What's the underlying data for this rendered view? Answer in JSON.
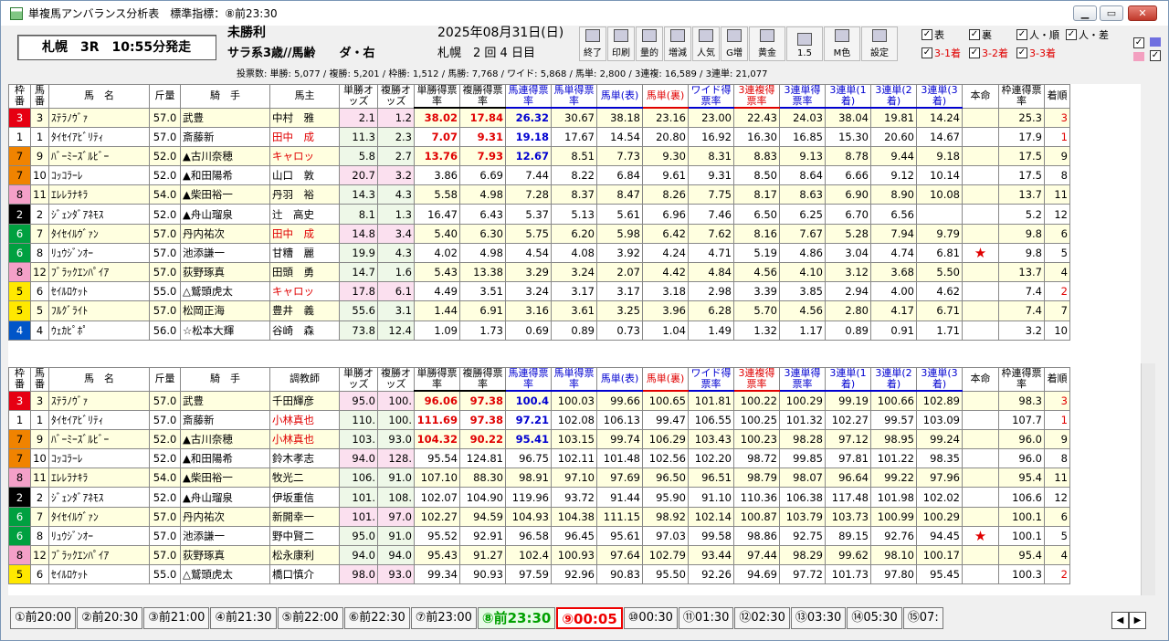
{
  "window": {
    "title": "単複馬アンバランス分析表　標準指標：⑧前23:30"
  },
  "race": {
    "name": "札幌　3R　10:55分発走",
    "condition": "未勝利",
    "detail": "サラ系3歳//馬齢　　ダ・右",
    "date": "2025年08月31日(日)",
    "place": "札幌　2 回 4 日目"
  },
  "votes": "投票数:  単勝: 5,077 / 複勝: 5,201 / 枠勝: 1,512 / 馬勝: 7,768 / ワイド: 5,868 / 馬単: 2,800 / 3連複: 16,589 / 3連単: 21,077",
  "toolbar": [
    "終了",
    "印刷",
    "量的",
    "増減",
    "人気",
    "G増",
    "黄金",
    "1.5",
    "M色",
    "設定"
  ],
  "checks": [
    "表",
    "裏",
    "人・順",
    "人・差",
    "3-1着",
    "3-2着",
    "3-3着"
  ],
  "colors": {
    "w1": "#ffffff",
    "w2": "#000000",
    "w3": "#e60012",
    "w4": "#0055c8",
    "w5": "#ffe800",
    "w6": "#00a040",
    "w7": "#f08300",
    "w8": "#f4a0c8",
    "red": "#e00000",
    "blue": "#0000d0"
  },
  "top": {
    "headers": [
      "枠番",
      "馬番",
      "馬　名",
      "斤量",
      "騎　手",
      "馬主",
      "単勝オッズ",
      "複勝オッズ",
      "単勝得票率",
      "複勝得票率",
      "馬連得票率",
      "馬単得票率",
      "馬単(表)",
      "馬単(裏)",
      "ワイド得票率",
      "3連複得票率",
      "3連単得票率",
      "3連単(1着)",
      "3連単(2着)",
      "3連単(3着)",
      "本命",
      "枠連得票率",
      "着順"
    ],
    "rows": [
      [
        "3",
        "3",
        "ｽﾃﾗﾉｳﾞｧ",
        "57.0",
        "武豊",
        "中村　雅",
        "2.1",
        "1.2",
        "38.02",
        "17.84",
        "26.32",
        "30.67",
        "38.18",
        "23.16",
        "23.00",
        "22.43",
        "24.03",
        "38.04",
        "19.81",
        "14.24",
        "",
        "25.3",
        "3"
      ],
      [
        "1",
        "1",
        "ﾀｲｾｲｱﾋﾞﾘﾃｨ",
        "57.0",
        "斎藤新",
        "田中　成",
        "11.3",
        "2.3",
        "7.07",
        "9.31",
        "19.18",
        "17.67",
        "14.54",
        "20.80",
        "16.92",
        "16.30",
        "16.85",
        "15.30",
        "20.60",
        "14.67",
        "",
        "17.9",
        "1"
      ],
      [
        "7",
        "9",
        "ﾊﾞｰﾐｰｽﾞﾙﾋﾞｰ",
        "52.0",
        "▲古川奈穂",
        "キャロッ",
        "5.8",
        "2.7",
        "13.76",
        "7.93",
        "12.67",
        "8.51",
        "7.73",
        "9.30",
        "8.31",
        "8.83",
        "9.13",
        "8.78",
        "9.44",
        "9.18",
        "",
        "17.5",
        "9"
      ],
      [
        "7",
        "10",
        "ｺｯｺﾗｰﾚ",
        "52.0",
        "▲和田陽希",
        "山口　敦",
        "20.7",
        "3.2",
        "3.86",
        "6.69",
        "7.44",
        "8.22",
        "6.84",
        "9.61",
        "9.31",
        "8.50",
        "8.64",
        "6.66",
        "9.12",
        "10.14",
        "",
        "17.5",
        "8"
      ],
      [
        "8",
        "11",
        "ｴﾚﾚﾗﾅｷﾗ",
        "54.0",
        "▲柴田裕一",
        "丹羽　裕",
        "14.3",
        "4.3",
        "5.58",
        "4.98",
        "7.28",
        "8.37",
        "8.47",
        "8.26",
        "7.75",
        "8.17",
        "8.63",
        "6.90",
        "8.90",
        "10.08",
        "",
        "13.7",
        "11"
      ],
      [
        "2",
        "2",
        "ｼﾞｪﾝﾀﾞｱﾈﾓｽ",
        "52.0",
        "▲舟山瑠泉",
        "辻　高史",
        "8.1",
        "1.3",
        "16.47",
        "6.43",
        "5.37",
        "5.13",
        "5.61",
        "6.96",
        "7.46",
        "6.50",
        "6.25",
        "6.70",
        "6.56",
        "",
        "",
        "5.2",
        "12"
      ],
      [
        "6",
        "7",
        "ﾀｲｾｲﾙｳﾞｧﾝ",
        "57.0",
        "丹内祐次",
        "田中　成",
        "14.8",
        "3.4",
        "5.40",
        "6.30",
        "5.75",
        "6.20",
        "5.98",
        "6.42",
        "7.62",
        "8.16",
        "7.67",
        "5.28",
        "7.94",
        "9.79",
        "",
        "9.8",
        "6"
      ],
      [
        "6",
        "8",
        "ﾘｭｳｼﾞﾝｵｰ",
        "57.0",
        "池添謙一",
        "甘糟　麗",
        "19.9",
        "4.3",
        "4.02",
        "4.98",
        "4.54",
        "4.08",
        "3.92",
        "4.24",
        "4.71",
        "5.19",
        "4.86",
        "3.04",
        "4.74",
        "6.81",
        "★",
        "9.8",
        "5"
      ],
      [
        "8",
        "12",
        "ﾌﾞﾗｯｸｴﾝﾊﾟｲｱ",
        "57.0",
        "荻野琢真",
        "田頭　勇",
        "14.7",
        "1.6",
        "5.43",
        "13.38",
        "3.29",
        "3.24",
        "2.07",
        "4.42",
        "4.84",
        "4.56",
        "4.10",
        "3.12",
        "3.68",
        "5.50",
        "",
        "13.7",
        "4"
      ],
      [
        "5",
        "6",
        "ｾｲﾙﾛｹｯﾄ",
        "55.0",
        "△鷲頭虎太",
        "キャロッ",
        "17.8",
        "6.1",
        "4.49",
        "3.51",
        "3.24",
        "3.17",
        "3.17",
        "3.18",
        "2.98",
        "3.39",
        "3.85",
        "2.94",
        "4.00",
        "4.62",
        "",
        "7.4",
        "2"
      ],
      [
        "5",
        "5",
        "ﾌﾙｸﾞﾗｲﾄ",
        "57.0",
        "松岡正海",
        "豊井　義",
        "55.6",
        "3.1",
        "1.44",
        "6.91",
        "3.16",
        "3.61",
        "3.25",
        "3.96",
        "6.28",
        "5.70",
        "4.56",
        "2.80",
        "4.17",
        "6.71",
        "",
        "7.4",
        "7"
      ],
      [
        "4",
        "4",
        "ｳｪｶﾋﾟﾎﾟ",
        "56.0",
        "☆松本大輝",
        "谷崎　森",
        "73.8",
        "12.4",
        "1.09",
        "1.73",
        "0.69",
        "0.89",
        "0.73",
        "1.04",
        "1.49",
        "1.32",
        "1.17",
        "0.89",
        "0.91",
        "1.71",
        "",
        "3.2",
        "10"
      ]
    ]
  },
  "bottom": {
    "headers": [
      "枠番",
      "馬番",
      "馬　名",
      "斤量",
      "騎　手",
      "調教師",
      "単勝オッズ",
      "複勝オッズ",
      "単勝得票率",
      "複勝得票率",
      "馬連得票率",
      "馬単得票率",
      "馬単(表)",
      "馬単(裏)",
      "ワイド得票率",
      "3連複得票率",
      "3連単得票率",
      "3連単(1着)",
      "3連単(2着)",
      "3連単(3着)",
      "本命",
      "枠連得票率",
      "着順"
    ],
    "rows": [
      [
        "3",
        "3",
        "ｽﾃﾗﾉｳﾞｧ",
        "57.0",
        "武豊",
        "千田輝彦",
        "95.0",
        "100.",
        "96.06",
        "97.38",
        "100.4",
        "100.03",
        "99.66",
        "100.65",
        "101.81",
        "100.22",
        "100.29",
        "99.19",
        "100.66",
        "102.89",
        "",
        "98.3",
        "3"
      ],
      [
        "1",
        "1",
        "ﾀｲｾｲｱﾋﾞﾘﾃｨ",
        "57.0",
        "斎藤新",
        "小林真也",
        "110.",
        "100.",
        "111.69",
        "97.38",
        "97.21",
        "102.08",
        "106.13",
        "99.47",
        "106.55",
        "100.25",
        "101.32",
        "102.27",
        "99.57",
        "103.09",
        "",
        "107.7",
        "1"
      ],
      [
        "7",
        "9",
        "ﾊﾞｰﾐｰｽﾞﾙﾋﾞｰ",
        "52.0",
        "▲古川奈穂",
        "小林真也",
        "103.",
        "93.0",
        "104.32",
        "90.22",
        "95.41",
        "103.15",
        "99.74",
        "106.29",
        "103.43",
        "100.23",
        "98.28",
        "97.12",
        "98.95",
        "99.24",
        "",
        "96.0",
        "9"
      ],
      [
        "7",
        "10",
        "ｺｯｺﾗｰﾚ",
        "52.0",
        "▲和田陽希",
        "鈴木孝志",
        "94.0",
        "128.",
        "95.54",
        "124.81",
        "96.75",
        "102.11",
        "101.48",
        "102.56",
        "102.20",
        "98.72",
        "99.85",
        "97.81",
        "101.22",
        "98.35",
        "",
        "96.0",
        "8"
      ],
      [
        "8",
        "11",
        "ｴﾚﾚﾗﾅｷﾗ",
        "54.0",
        "▲柴田裕一",
        "牧光二",
        "106.",
        "91.0",
        "107.10",
        "88.30",
        "98.91",
        "97.10",
        "97.69",
        "96.50",
        "96.51",
        "98.79",
        "98.07",
        "96.64",
        "99.22",
        "97.96",
        "",
        "95.4",
        "11"
      ],
      [
        "2",
        "2",
        "ｼﾞｪﾝﾀﾞｱﾈﾓｽ",
        "52.0",
        "▲舟山瑠泉",
        "伊坂重信",
        "101.",
        "108.",
        "102.07",
        "104.90",
        "119.96",
        "93.72",
        "91.44",
        "95.90",
        "91.10",
        "110.36",
        "106.38",
        "117.48",
        "101.98",
        "102.02",
        "",
        "106.6",
        "12"
      ],
      [
        "6",
        "7",
        "ﾀｲｾｲﾙｳﾞｧﾝ",
        "57.0",
        "丹内祐次",
        "新開幸一",
        "101.",
        "97.0",
        "102.27",
        "94.59",
        "104.93",
        "104.38",
        "111.15",
        "98.92",
        "102.14",
        "100.87",
        "103.79",
        "103.73",
        "100.99",
        "100.29",
        "",
        "100.1",
        "6"
      ],
      [
        "6",
        "8",
        "ﾘｭｳｼﾞﾝｵｰ",
        "57.0",
        "池添謙一",
        "野中賢二",
        "95.0",
        "91.0",
        "95.52",
        "92.91",
        "96.58",
        "96.45",
        "95.61",
        "97.03",
        "99.58",
        "98.86",
        "92.75",
        "89.15",
        "92.76",
        "94.45",
        "★",
        "100.1",
        "5"
      ],
      [
        "8",
        "12",
        "ﾌﾞﾗｯｸｴﾝﾊﾟｲｱ",
        "57.0",
        "荻野琢真",
        "松永康利",
        "94.0",
        "94.0",
        "95.43",
        "91.27",
        "102.4",
        "100.93",
        "97.64",
        "102.79",
        "93.44",
        "97.44",
        "98.29",
        "99.62",
        "98.10",
        "100.17",
        "",
        "95.4",
        "4"
      ],
      [
        "5",
        "6",
        "ｾｲﾙﾛｹｯﾄ",
        "55.0",
        "△鷲頭虎太",
        "橋口慎介",
        "98.0",
        "93.0",
        "99.34",
        "90.93",
        "97.59",
        "92.96",
        "90.83",
        "95.50",
        "92.26",
        "94.69",
        "97.72",
        "101.73",
        "97.80",
        "95.45",
        "",
        "100.3",
        "2"
      ]
    ]
  },
  "tabs": [
    "①前20:00",
    "②前20:30",
    "③前21:00",
    "④前21:30",
    "⑤前22:00",
    "⑥前22:30",
    "⑦前23:00",
    "⑧前23:30",
    "⑨00:05",
    "⑩00:30",
    "⑪01:30",
    "⑫02:30",
    "⑬03:30",
    "⑭05:30",
    "⑮07:"
  ]
}
